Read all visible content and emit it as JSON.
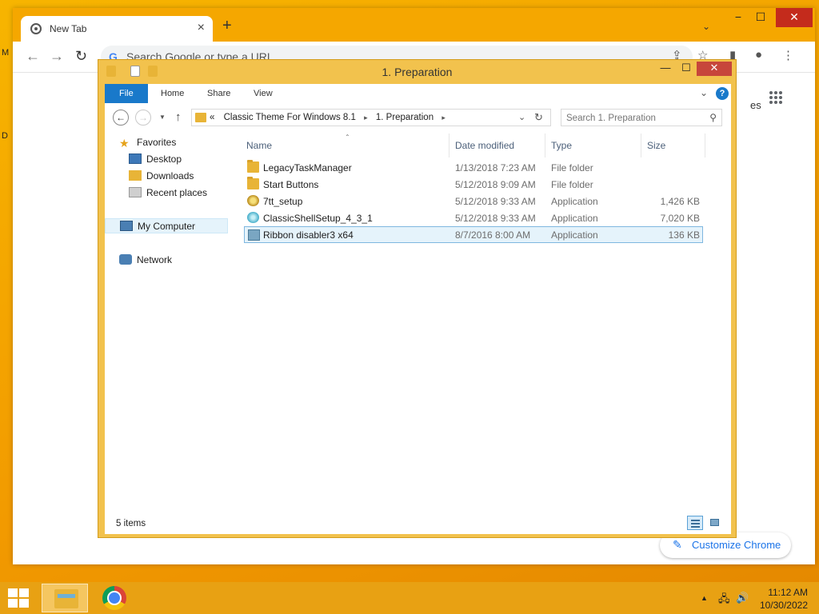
{
  "desktop": {
    "label_top": "M",
    "label_mid": "D"
  },
  "chrome": {
    "tab_title": "New Tab",
    "tab_close": "×",
    "new_tab": "+",
    "tab_dropdown": "⌄",
    "win_min": "−",
    "win_max": "☐",
    "win_close": "✕",
    "back": "←",
    "forward": "→",
    "reload": "↻",
    "omnibox_g": "G",
    "omnibox_placeholder": "Search Google or type a URL",
    "share": "⇪",
    "bookmark": "☆",
    "side_panel": "▮",
    "profile": "●",
    "menu": "⋮",
    "shortcut_edge_text": "es",
    "customize_label": "Customize Chrome",
    "customize_icon": "✎"
  },
  "explorer": {
    "title": "1. Preparation",
    "win_min": "—",
    "win_max": "☐",
    "win_close": "✕",
    "ribbon_tabs": [
      "File",
      "Home",
      "Share",
      "View"
    ],
    "ribbon_chevron": "⌄",
    "help": "?",
    "nav_back": "←",
    "nav_forward": "→",
    "nav_recent": "▼",
    "nav_up": "↑",
    "address": {
      "prefix": "«",
      "crumbs": [
        "Classic Theme For Windows 8.1",
        "1. Preparation"
      ],
      "separator": "▸",
      "dropdown": "⌄",
      "refresh": "↻"
    },
    "search_placeholder": "Search 1. Preparation",
    "search_icon": "⚲",
    "nav_pane": {
      "favorites": "Favorites",
      "desktop": "Desktop",
      "downloads": "Downloads",
      "recent_places": "Recent places",
      "my_computer": "My Computer",
      "network": "Network"
    },
    "columns": {
      "name": "Name",
      "date": "Date modified",
      "type": "Type",
      "size": "Size",
      "sort_caret": "⌃"
    },
    "files": [
      {
        "name": "LegacyTaskManager",
        "date": "1/13/2018 7:23 AM",
        "type": "File folder",
        "size": ""
      },
      {
        "name": "Start Buttons",
        "date": "5/12/2018 9:09 AM",
        "type": "File folder",
        "size": ""
      },
      {
        "name": "7tt_setup",
        "date": "5/12/2018 9:33 AM",
        "type": "Application",
        "size": "1,426 KB"
      },
      {
        "name": "ClassicShellSetup_4_3_1",
        "date": "5/12/2018 9:33 AM",
        "type": "Application",
        "size": "7,020 KB"
      },
      {
        "name": "Ribbon disabler3 x64",
        "date": "8/7/2016 8:00 AM",
        "type": "Application",
        "size": "136 KB"
      }
    ],
    "status": "5 items"
  },
  "taskbar": {
    "tray_chevron": "▲",
    "tray_network": "🖧",
    "tray_volume": "🔊",
    "time": "11:12 AM",
    "date": "10/30/2022"
  },
  "colors": {
    "accent": "#1979ca",
    "selection": "#e5f3fb",
    "desktop": "#f6a800",
    "window_frame": "#f2c24d"
  }
}
